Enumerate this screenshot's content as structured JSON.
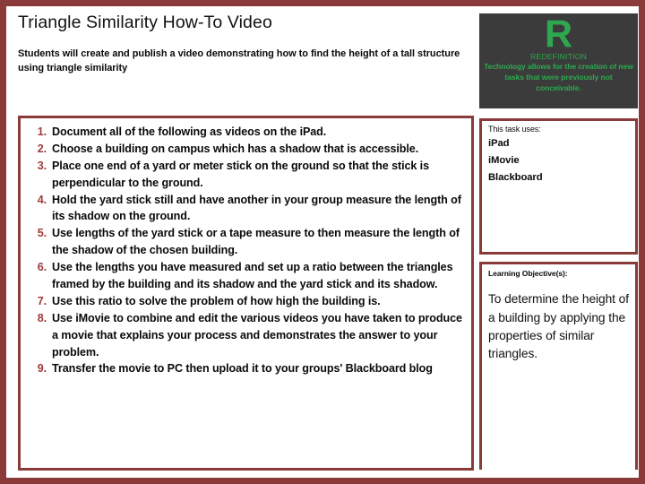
{
  "slide": {
    "title": "Triangle Similarity How-To Video",
    "subtitle": "Students will create and publish a video demonstrating how to find the height of a tall structure using triangle similarity",
    "border_color": "#8B3A3A"
  },
  "steps": [
    {
      "number": "1.",
      "text": "Document all of the following as videos on the iPad."
    },
    {
      "number": "2.",
      "text": "Choose a building on campus which has a shadow that is accessible."
    },
    {
      "number": "3.",
      "text": "Place one end of a yard or meter stick on the ground so that the stick is perpendicular to the ground."
    },
    {
      "number": "4.",
      "text": "Hold the yard stick still and have another in your group measure the length of its shadow on the ground."
    },
    {
      "number": "5.",
      "text": "Use lengths of the yard stick or a tape measure to then measure the length of the shadow of the chosen building."
    },
    {
      "number": "6.",
      "text": "Use the lengths you have measured and set up a ratio between the triangles framed by the building and its shadow and the yard stick and its shadow."
    },
    {
      "number": "7.",
      "text": "Use this ratio to solve the problem of how high the building is."
    },
    {
      "number": "8.",
      "text": "Use iMovie to combine and edit the various videos you have taken to produce a movie that explains your process and demonstrates the answer to your problem."
    },
    {
      "number": "9.",
      "text": "Transfer the movie to PC then upload it to your groups' Blackboard blog"
    }
  ],
  "samr": {
    "letter": "R",
    "label": "REDEFINITION",
    "description": "Technology allows for the creation of new tasks that were previously not conceivable.",
    "text_color": "#2EA84F",
    "background_color": "#3B3B3B"
  },
  "tools": {
    "heading": "This task uses:",
    "items": [
      "iPad",
      "iMovie",
      "Blackboard"
    ]
  },
  "objective": {
    "heading": "Learning Objective(s):",
    "text": "To determine the height of a building by applying the properties of similar triangles."
  }
}
